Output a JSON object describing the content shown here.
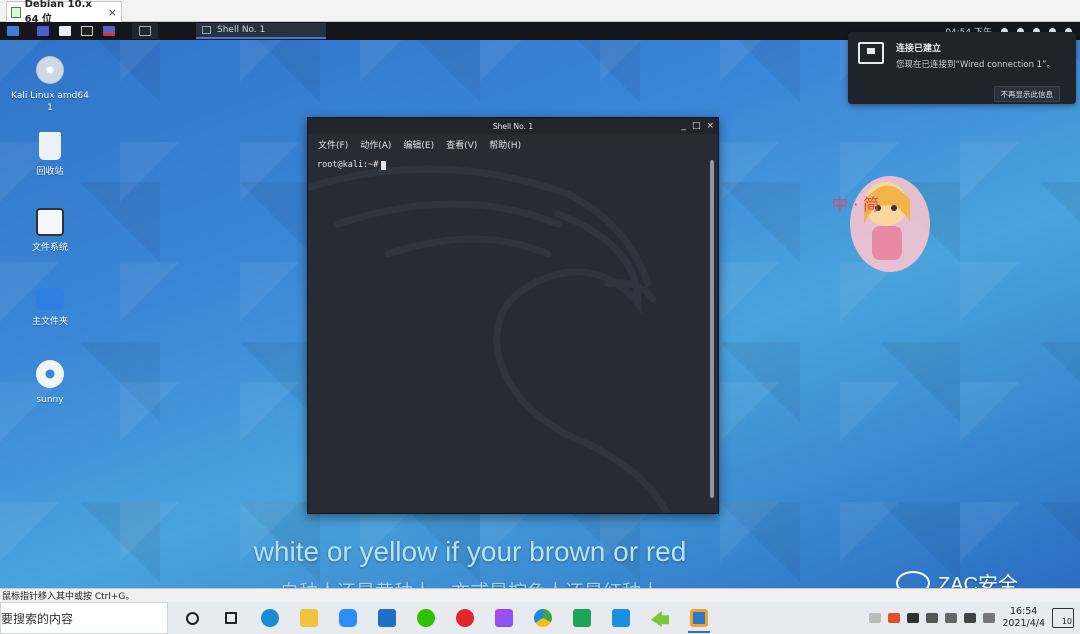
{
  "vmware": {
    "tab_title": "Debian 10.x 64 位",
    "tab_close": "×",
    "status_text": "鼠标指针移入其中或按 Ctrl+G。"
  },
  "kali_panel": {
    "task_label": "Shell No. 1",
    "clock": "04:54 下午"
  },
  "desktop_icons": [
    {
      "label": "Kali Linux amd64 1",
      "icon": "kali-disc-icon"
    },
    {
      "label": "回收站",
      "icon": "trash-icon"
    },
    {
      "label": "文件系统",
      "icon": "drive-icon"
    },
    {
      "label": "主文件夹",
      "icon": "home-folder-icon"
    },
    {
      "label": "sunny",
      "icon": "gear-icon"
    }
  ],
  "notification": {
    "title": "连接已建立",
    "body": "您现在已连接到“Wired connection 1”。",
    "button": "不再显示此信息"
  },
  "terminal": {
    "title": "Shell No. 1",
    "controls": [
      "_",
      "□",
      "×"
    ],
    "menu": [
      "文件(F)",
      "动作(A)",
      "编辑(E)",
      "查看(V)",
      "帮助(H)"
    ],
    "prompt": "root@kali:~# "
  },
  "mascot_text": "中 · 简",
  "subtitles": {
    "english": "white or yellow  if your brown or red",
    "chinese": "白种人还是黄种人，亦或是棕色人还是红种人"
  },
  "watermark": "ZAC安全",
  "taskbar": {
    "search_placeholder": "要搜索的内容",
    "time": "16:54",
    "date": "2021/4/4",
    "notification_count": "10"
  },
  "colors": {
    "desktop_blue": "#3b86d6",
    "terminal_bg": "#262b34",
    "subtitle_en": "#b9e2ff",
    "subtitle_cn": "#9fd3ff"
  }
}
